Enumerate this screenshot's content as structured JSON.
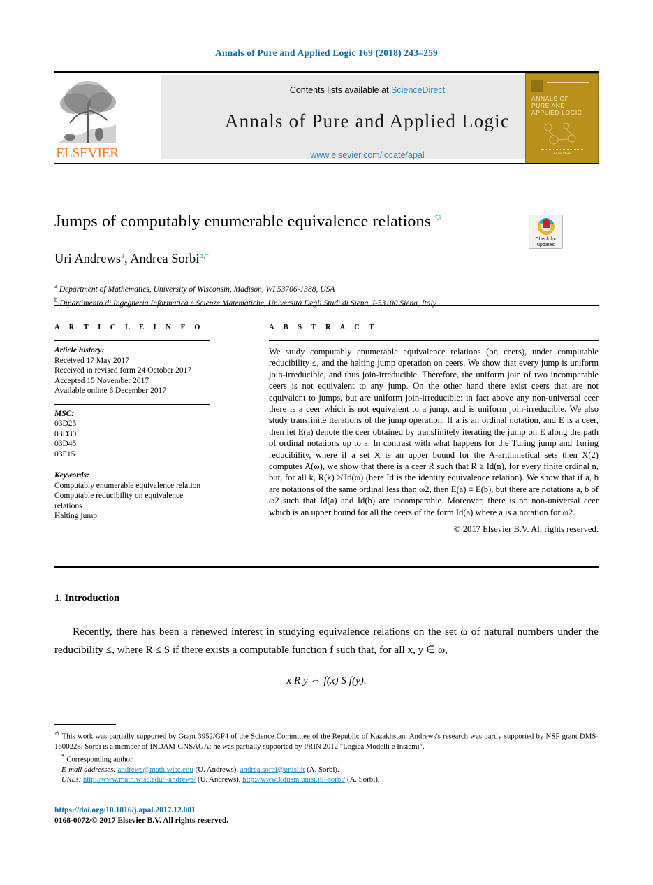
{
  "running_head": "Annals of Pure and Applied Logic 169 (2018) 243–259",
  "masthead": {
    "contents_prefix": "Contents lists available at ",
    "sciencedirect": "ScienceDirect",
    "journal_name": "Annals of Pure and Applied Logic",
    "journal_url": "www.elsevier.com/locate/apal",
    "publisher_logo_text": "ELSEVIER",
    "cover": {
      "line1": "ANNALS OF",
      "line2": "PURE AND",
      "line3": "APPLIED LOGIC",
      "footer": "ELSEVIER"
    }
  },
  "article": {
    "title": "Jumps of computably enumerable equivalence relations",
    "title_footnote_mark": "✩",
    "authors": [
      {
        "name": "Uri Andrews",
        "sup": "a"
      },
      {
        "name": "Andrea Sorbi",
        "sup": "b,*"
      }
    ],
    "authors_line": "Uri Andrews",
    "affiliations": [
      {
        "mark": "a",
        "text": "Department of Mathematics, University of Wisconsin, Madison, WI 53706-1388, USA"
      },
      {
        "mark": "b",
        "text": "Dipartimento di Ingegneria Informatica e Scienze Matematiche, Università Degli Studi di Siena, I-53100 Siena, Italy"
      }
    ]
  },
  "crossmark": {
    "line1": "Check for",
    "line2": "updates"
  },
  "headings": {
    "article_info": "A R T I C L E   I N F O",
    "abstract": "A B S T R A C T"
  },
  "article_info": {
    "history_label": "Article history:",
    "history": [
      "Received 17 May 2017",
      "Received in revised form 24 October 2017",
      "Accepted 15 November 2017",
      "Available online 6 December 2017"
    ],
    "msc_label": "MSC:",
    "msc": [
      "03D25",
      "03D30",
      "03D45",
      "03F15"
    ],
    "keywords_label": "Keywords:",
    "keywords": [
      "Computably enumerable equivalence relation",
      "Computable reducibility on equivalence relations",
      "Halting jump"
    ]
  },
  "abstract": {
    "text": "We study computably enumerable equivalence relations (or, ceers), under computable reducibility ≤, and the halting jump operation on ceers. We show that every jump is uniform join-irreducible, and thus join-irreducible. Therefore, the uniform join of two incomparable ceers is not equivalent to any jump. On the other hand there exist ceers that are not equivalent to jumps, but are uniform join-irreducible: in fact above any non-universal ceer there is a ceer which is not equivalent to a jump, and is uniform join-irreducible. We also study transfinite iterations of the jump operation. If a is an ordinal notation, and E is a ceer, then let E(a) denote the ceer obtained by transfinitely iterating the jump on E along the path of ordinal notations up to a. In contrast with what happens for the Turing jump and Turing reducibility, where if a set X is an upper bound for the A-arithmetical sets then X(2) computes A(ω), we show that there is a ceer R such that R ≥ Id(n), for every finite ordinal n, but, for all k, R(k) ≱ Id(ω) (here Id is the identity equivalence relation). We show that if a, b are notations of the same ordinal less than ω2, then E(a) ≡ E(b), but there are notations a, b of ω2 such that Id(a) and Id(b) are incomparable. Moreover, there is no non-universal ceer which is an upper bound for all the ceers of the form Id(a) where a is a notation for ω2.",
    "copyright": "© 2017 Elsevier B.V. All rights reserved."
  },
  "body": {
    "section_number": "1.",
    "section_title": "Introduction",
    "paragraph": "Recently, there has been a renewed interest in studying equivalence relations on the set ω of natural numbers under the reducibility ≤, where R ≤ S if there exists a computable function f such that, for all x, y ∈ ω,",
    "equation": "x R y ⇔ f(x) S f(y)."
  },
  "footnotes": {
    "grant": "This work was partially supported by Grant 3952/GF4 of the Science Committee of the Republic of Kazakhstan. Andrews's research was partly supported by NSF grant DMS-1600228. Sorbi is a member of INDAM-GNSAGA; he was partially supported by PRIN 2012 \"Logica Modelli e Insiemi\".",
    "corresponding": "Corresponding author.",
    "email_label": "E-mail addresses:",
    "emails": [
      {
        "address": "andrews@math.wisc.edu",
        "owner": "(U. Andrews),"
      },
      {
        "address": "andrea.sorbi@unisi.it",
        "owner": "(A. Sorbi)."
      }
    ],
    "urls_label": "URLs:",
    "urls": [
      {
        "address": "http://www.math.wisc.edu/~andrews/",
        "owner": "(U. Andrews),"
      },
      {
        "address": "http://www3.diism.unisi.it/~sorbi/",
        "owner": "(A. Sorbi)."
      }
    ]
  },
  "bottom": {
    "doi": "https://doi.org/10.1016/j.apal.2017.12.001",
    "issn_line": "0168-0072/© 2017 Elsevier B.V. All rights reserved."
  },
  "colors": {
    "link": "#1f8ac0",
    "runhead": "#0b6aa2",
    "elsevier_orange": "#f47920",
    "cover_gold": "#b8901b",
    "band_gray": "#e9e9e9"
  }
}
